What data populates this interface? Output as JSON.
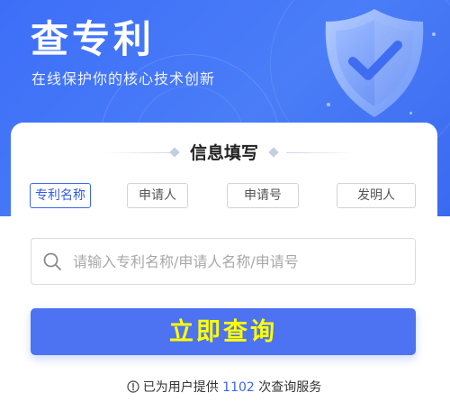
{
  "hero": {
    "title": "查专利",
    "subtitle": "在线保护你的核心技术创新"
  },
  "form": {
    "section_title": "信息填写",
    "tabs": [
      {
        "label": "专利名称",
        "active": true
      },
      {
        "label": "申请人",
        "active": false
      },
      {
        "label": "申请号",
        "active": false
      },
      {
        "label": "发明人",
        "active": false
      }
    ],
    "search": {
      "placeholder": "请输入专利名称/申请人名称/申请号",
      "value": "",
      "icon": "search-icon"
    },
    "submit_label": "立即查询"
  },
  "footer": {
    "icon": "info-icon",
    "prefix": "已为用户提供",
    "count": "1102",
    "suffix": "次查询服务"
  },
  "colors": {
    "hero_background": "#4a7df7",
    "accent": "#3a66f0",
    "button_background": "#4d72f2",
    "button_text": "#ffff00"
  }
}
